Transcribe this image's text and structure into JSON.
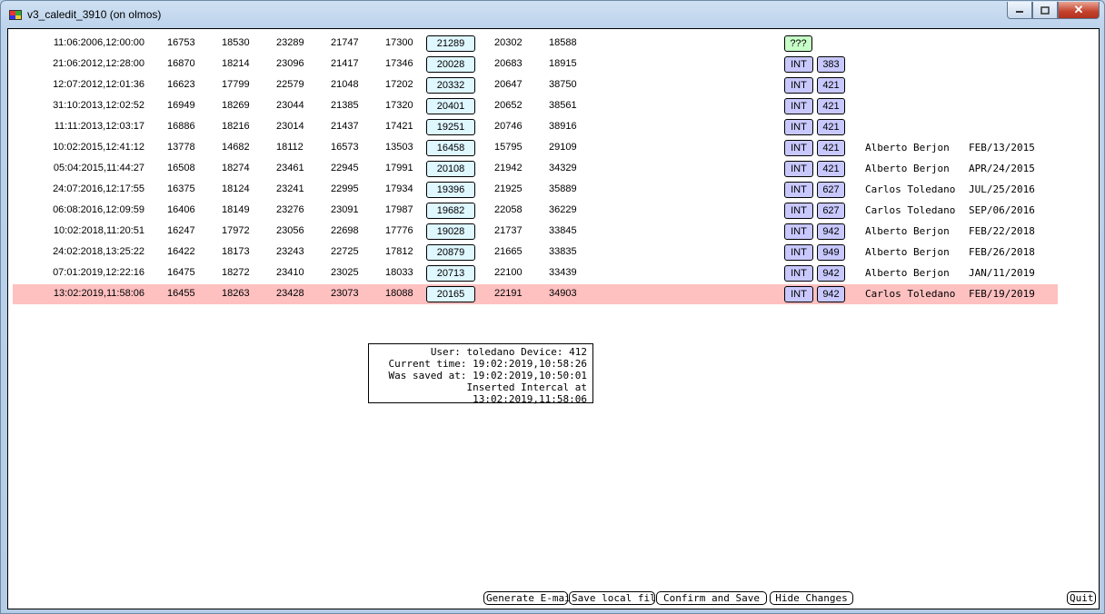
{
  "window": {
    "title": "v3_caledit_3910 (on olmos)"
  },
  "rows": [
    {
      "date": "11:06:2006,12:00:00",
      "v1": "16753",
      "v2": "18530",
      "v3": "23289",
      "v4": "21747",
      "v5": "17300",
      "box": "21289",
      "v6": "20302",
      "v7": "18588",
      "tag": "???",
      "num": "",
      "name": "",
      "when": "",
      "highlight": false
    },
    {
      "date": "21:06:2012,12:28:00",
      "v1": "16870",
      "v2": "18214",
      "v3": "23096",
      "v4": "21417",
      "v5": "17346",
      "box": "20028",
      "v6": "20683",
      "v7": "18915",
      "tag": "INT",
      "num": "383",
      "name": "",
      "when": "",
      "highlight": false
    },
    {
      "date": "12:07:2012,12:01:36",
      "v1": "16623",
      "v2": "17799",
      "v3": "22579",
      "v4": "21048",
      "v5": "17202",
      "box": "20332",
      "v6": "20647",
      "v7": "38750",
      "tag": "INT",
      "num": "421",
      "name": "",
      "when": "",
      "highlight": false
    },
    {
      "date": "31:10:2013,12:02:52",
      "v1": "16949",
      "v2": "18269",
      "v3": "23044",
      "v4": "21385",
      "v5": "17320",
      "box": "20401",
      "v6": "20652",
      "v7": "38561",
      "tag": "INT",
      "num": "421",
      "name": "",
      "when": "",
      "highlight": false
    },
    {
      "date": "11:11:2013,12:03:17",
      "v1": "16886",
      "v2": "18216",
      "v3": "23014",
      "v4": "21437",
      "v5": "17421",
      "box": "19251",
      "v6": "20746",
      "v7": "38916",
      "tag": "INT",
      "num": "421",
      "name": "",
      "when": "",
      "highlight": false
    },
    {
      "date": "10:02:2015,12:41:12",
      "v1": "13778",
      "v2": "14682",
      "v3": "18112",
      "v4": "16573",
      "v5": "13503",
      "box": "16458",
      "v6": "15795",
      "v7": "29109",
      "tag": "INT",
      "num": "421",
      "name": "Alberto Berjon",
      "when": "FEB/13/2015",
      "highlight": false
    },
    {
      "date": "05:04:2015,11:44:27",
      "v1": "16508",
      "v2": "18274",
      "v3": "23461",
      "v4": "22945",
      "v5": "17991",
      "box": "20108",
      "v6": "21942",
      "v7": "34329",
      "tag": "INT",
      "num": "421",
      "name": "Alberto Berjon",
      "when": "APR/24/2015",
      "highlight": false
    },
    {
      "date": "24:07:2016,12:17:55",
      "v1": "16375",
      "v2": "18124",
      "v3": "23241",
      "v4": "22995",
      "v5": "17934",
      "box": "19396",
      "v6": "21925",
      "v7": "35889",
      "tag": "INT",
      "num": "627",
      "name": "Carlos Toledano",
      "when": "JUL/25/2016",
      "highlight": false
    },
    {
      "date": "06:08:2016,12:09:59",
      "v1": "16406",
      "v2": "18149",
      "v3": "23276",
      "v4": "23091",
      "v5": "17987",
      "box": "19682",
      "v6": "22058",
      "v7": "36229",
      "tag": "INT",
      "num": "627",
      "name": "Carlos Toledano",
      "when": "SEP/06/2016",
      "highlight": false
    },
    {
      "date": "10:02:2018,11:20:51",
      "v1": "16247",
      "v2": "17972",
      "v3": "23056",
      "v4": "22698",
      "v5": "17776",
      "box": "19028",
      "v6": "21737",
      "v7": "33845",
      "tag": "INT",
      "num": "942",
      "name": "Alberto Berjon",
      "when": "FEB/22/2018",
      "highlight": false
    },
    {
      "date": "24:02:2018,13:25:22",
      "v1": "16422",
      "v2": "18173",
      "v3": "23243",
      "v4": "22725",
      "v5": "17812",
      "box": "20879",
      "v6": "21665",
      "v7": "33835",
      "tag": "INT",
      "num": "949",
      "name": "Alberto Berjon",
      "when": "FEB/26/2018",
      "highlight": false
    },
    {
      "date": "07:01:2019,12:22:16",
      "v1": "16475",
      "v2": "18272",
      "v3": "23410",
      "v4": "23025",
      "v5": "18033",
      "box": "20713",
      "v6": "22100",
      "v7": "33439",
      "tag": "INT",
      "num": "942",
      "name": "Alberto Berjon",
      "when": "JAN/11/2019",
      "highlight": false
    },
    {
      "date": "13:02:2019,11:58:06",
      "v1": "16455",
      "v2": "18263",
      "v3": "23428",
      "v4": "23073",
      "v5": "18088",
      "box": "20165",
      "v6": "22191",
      "v7": "34903",
      "tag": "INT",
      "num": "942",
      "name": "Carlos Toledano",
      "when": "FEB/19/2019",
      "highlight": true
    }
  ],
  "info": {
    "line1": "User: toledano Device: 412",
    "line2": "Current time: 19:02:2019,10:58:26",
    "line3": "Was saved at: 19:02:2019,10:50:01",
    "line4": "Inserted Intercal at 13:02:2019,11:58:06"
  },
  "buttons": {
    "email": "Generate E-mail",
    "local": "Save local file",
    "confirm": "Confirm and Save",
    "hide": "Hide Changes",
    "quit": "Quit"
  }
}
